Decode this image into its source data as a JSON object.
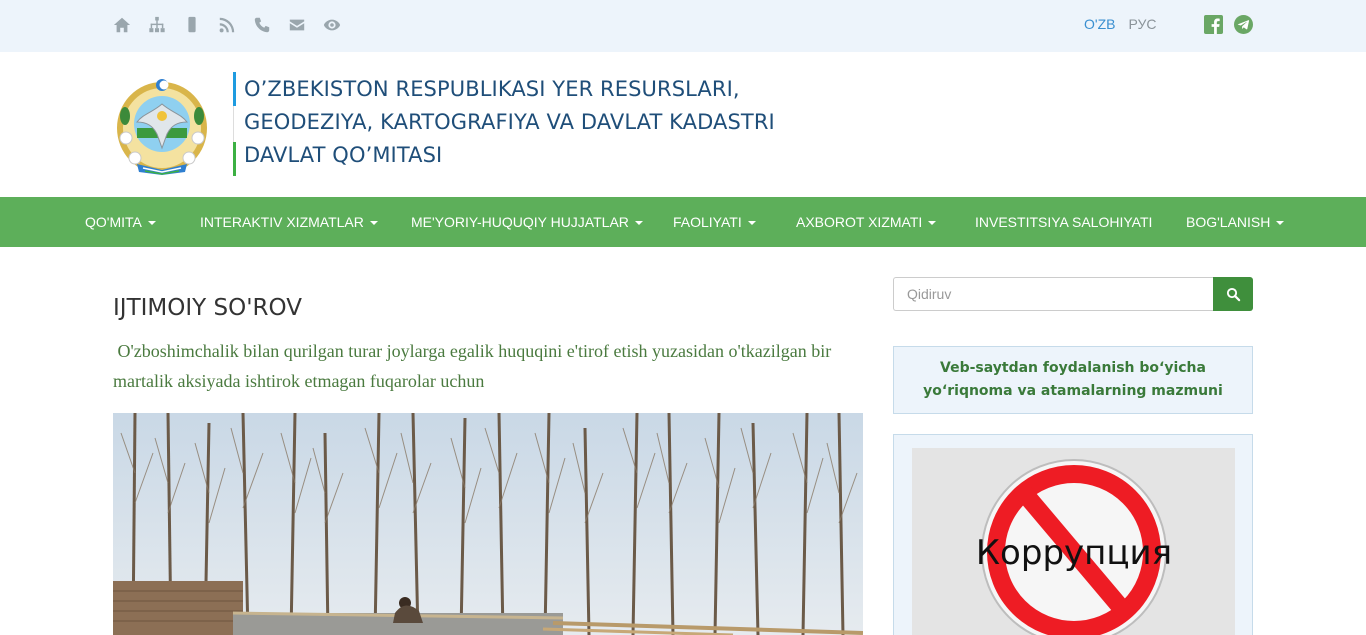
{
  "topbar": {
    "icons": [
      "home-icon",
      "sitemap-icon",
      "mobile-icon",
      "rss-icon",
      "phone-icon",
      "envelope-icon",
      "eye-icon"
    ],
    "languages": [
      {
        "label": "O'ZB",
        "active": true
      },
      {
        "label": "РУС",
        "active": false
      }
    ],
    "socials": [
      "facebook-icon",
      "telegram-icon"
    ]
  },
  "header": {
    "title_lines": [
      "O’ZBEKISTON RESPUBLIKASI YER RESURSLARI,",
      "GEODEZIYA, KARTOGRAFIYA VA DAVLAT KADASTRI",
      "DAVLAT QO’MITASI"
    ]
  },
  "nav": {
    "items": [
      {
        "label": "QO'MITA",
        "dropdown": true
      },
      {
        "label": "INTERAKTIV XIZMATLAR",
        "dropdown": true
      },
      {
        "label": "ME'YORIY-HUQUQIY HUJJATLAR",
        "dropdown": true
      },
      {
        "label": "FAOLIYATI",
        "dropdown": true
      },
      {
        "label": "AXBOROT XIZMATI",
        "dropdown": true
      },
      {
        "label": "INVESTITSIYA SALOHIYATI",
        "dropdown": false
      },
      {
        "label": "BOG'LANISH",
        "dropdown": true
      }
    ]
  },
  "main": {
    "title": "IJTIMOIY SO'ROV",
    "intro": " O'zboshimchalik bilan qurilgan turar joylarga egalik huquqini e'tirof etish yuzasidan o'tkazilgan bir martalik aksiyada ishtirok etmagan fuqarolar uchun"
  },
  "sidebar": {
    "search_placeholder": "Qidiruv",
    "guide_text": "Veb-saytdan foydalanish bo‘yicha yo‘riqnoma va atamalarning mazmuni",
    "banner_text": "Коррупция"
  },
  "colors": {
    "topbar_bg": "#edf4fb",
    "nav_bg": "#5daf5a",
    "title_color": "#1f4e79",
    "accent_blue": "#3a8fd0",
    "accent_green": "#3f8f3c"
  }
}
